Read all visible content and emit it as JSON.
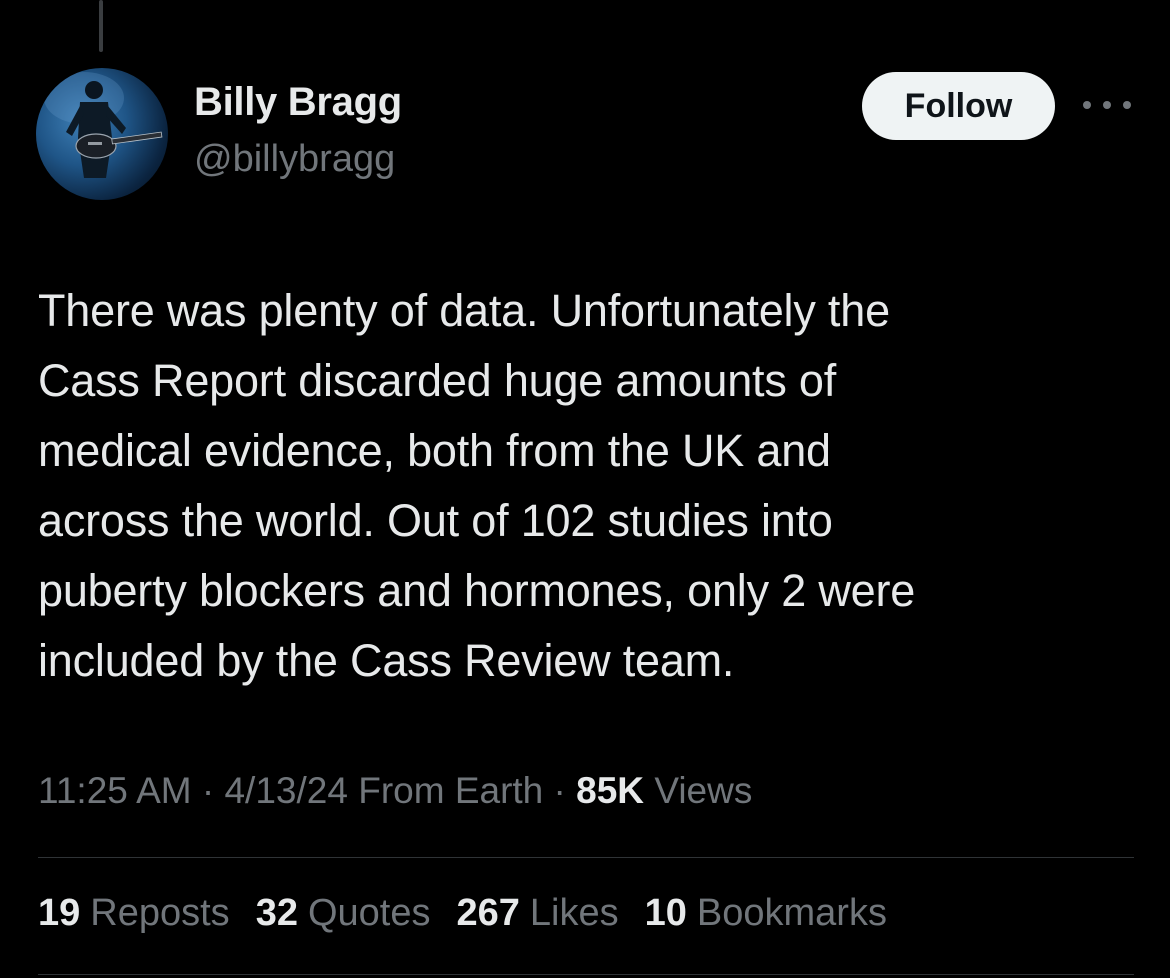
{
  "author": {
    "display_name": "Billy Bragg",
    "handle": "@billybragg"
  },
  "actions": {
    "follow_label": "Follow"
  },
  "tweet": {
    "text": "There was plenty of data. Unfortunately the\nCass Report discarded huge amounts of\nmedical evidence, both from the UK and\nacross the world. Out of 102 studies into\npuberty blockers and hormones, only 2 were\nincluded by the Cass Review team."
  },
  "meta": {
    "time": "11:25 AM",
    "separator": " · ",
    "date": "4/13/24",
    "location": " From Earth",
    "views_count": "85K",
    "views_label": " Views"
  },
  "stats": [
    {
      "count": "19",
      "label": "Reposts"
    },
    {
      "count": "32",
      "label": "Quotes"
    },
    {
      "count": "267",
      "label": "Likes"
    },
    {
      "count": "10",
      "label": "Bookmarks"
    }
  ],
  "colors": {
    "background": "#000000",
    "primary_text": "#e7e9ea",
    "secondary_text": "#71767b",
    "follow_bg": "#eff3f4"
  }
}
